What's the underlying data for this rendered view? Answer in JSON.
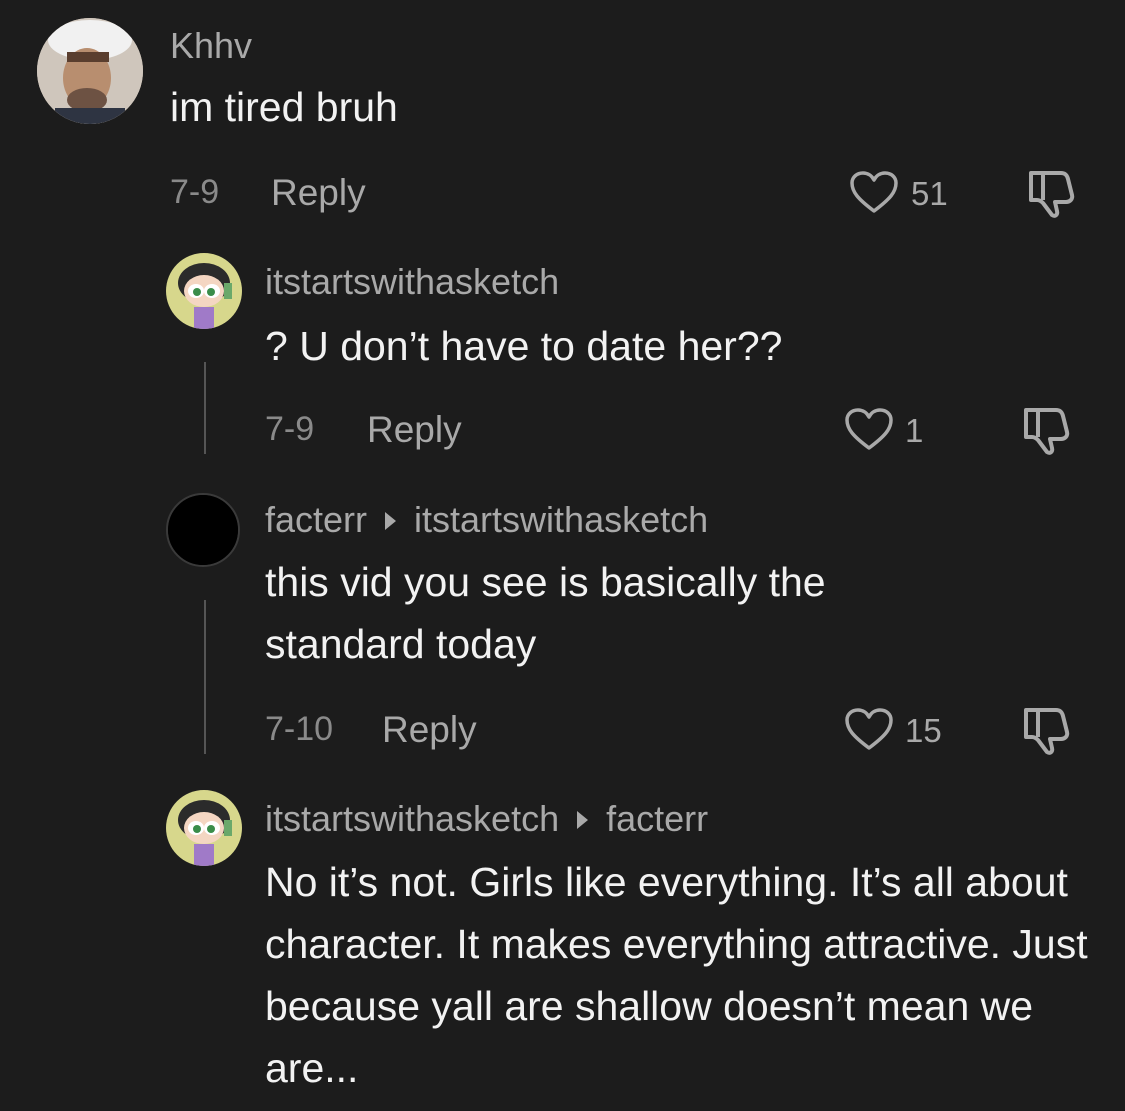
{
  "comments": [
    {
      "username": "Khhv",
      "text": "im tired bruh",
      "date": "7-9",
      "reply_label": "Reply",
      "likes": "51",
      "avatar_icon": "profile-photo-icon"
    },
    {
      "username": "itstartswithasketch",
      "text": "? U don’t have to date her??",
      "date": "7-9",
      "reply_label": "Reply",
      "likes": "1",
      "avatar_icon": "cartoon-avatar-icon"
    },
    {
      "username": "facterr",
      "reply_to": "itstartswithasketch",
      "text": "this vid you see is basically the standard today",
      "date": "7-10",
      "reply_label": "Reply",
      "likes": "15",
      "avatar_icon": "black-avatar-icon"
    },
    {
      "username": "itstartswithasketch",
      "reply_to": "facterr",
      "text": "No it’s not. Girls like everything. It’s all about character. It makes everything attractive. Just because yall are shallow doesn’t mean we are...",
      "avatar_icon": "cartoon-avatar-icon"
    }
  ],
  "colors": {
    "background": "#1c1c1c",
    "username": "#a9a9a9",
    "text": "#f2f2f2",
    "meta": "#8a8a8a"
  }
}
